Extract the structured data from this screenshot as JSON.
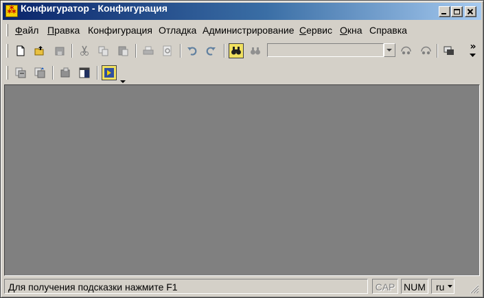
{
  "window": {
    "title": "Конфигуратор - Конфигурация"
  },
  "menu": [
    {
      "label": "Файл",
      "mnemonic": "Ф",
      "rest": "айл"
    },
    {
      "label": "Правка",
      "mnemonic": "П",
      "rest": "равка"
    },
    {
      "label": "Конфигурация",
      "mnemonic": "",
      "rest": "Конфигурация"
    },
    {
      "label": "Отладка",
      "mnemonic": "",
      "rest": "Отладка"
    },
    {
      "label": "Администрирование",
      "mnemonic": "",
      "rest": "Администрирование"
    },
    {
      "label": "Сервис",
      "mnemonic": "С",
      "rest": "ервис"
    },
    {
      "label": "Окна",
      "mnemonic": "О",
      "rest": "кна"
    },
    {
      "label": "Справка",
      "mnemonic": "",
      "rest": "Справка"
    }
  ],
  "toolbar": {
    "search_value": "",
    "overflow_glyph": "»"
  },
  "status": {
    "hint": "Для получения подсказки нажмите F1",
    "cap": "CAP",
    "num": "NUM",
    "lang": "ru"
  },
  "colors": {
    "titlebar_start": "#0a246a",
    "titlebar_end": "#a6caf0",
    "face": "#d4d0c8",
    "workspace": "#808080"
  }
}
